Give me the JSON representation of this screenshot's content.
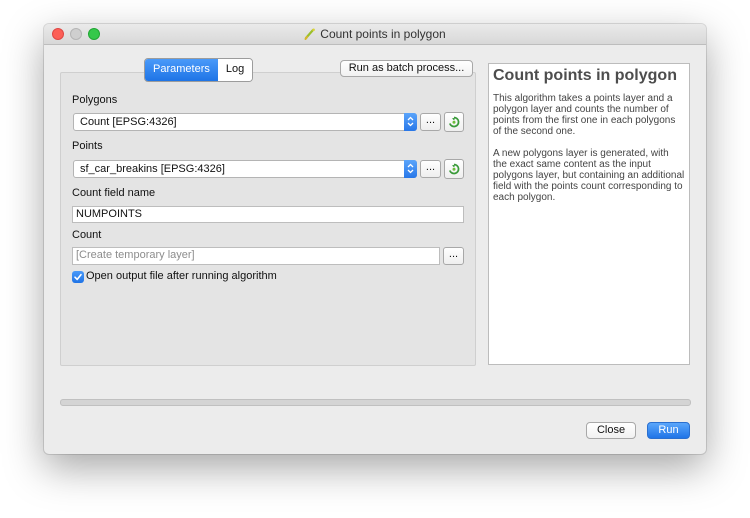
{
  "window": {
    "title": "Count points in polygon"
  },
  "tabs": [
    {
      "label": "Parameters",
      "active": true
    },
    {
      "label": "Log",
      "active": false
    }
  ],
  "batch_button_label": "Run as batch process...",
  "fields": {
    "polygons_label": "Polygons",
    "polygons_value": "Count [EPSG:4326]",
    "points_label": "Points",
    "points_value": "sf_car_breakins [EPSG:4326]",
    "count_field_label": "Count field name",
    "count_field_value": "NUMPOINTS",
    "count_label": "Count",
    "count_placeholder": "[Create temporary layer]",
    "browse_label": "...",
    "open_output_label": "Open output file after running algorithm",
    "open_output_checked": true
  },
  "help": {
    "title": "Count points in polygon",
    "paragraphs": [
      "This algorithm takes a points layer and a polygon layer and counts the number of points from the first one in each polygons of the second one.",
      "A new polygons layer is generated, with the exact same content as the input polygons layer, but containing an additional field with the points count corresponding to each polygon."
    ]
  },
  "buttons": {
    "close": "Close",
    "run": "Run"
  },
  "progress": 0,
  "colors": {
    "accent": "#2a7cec",
    "window_bg": "#ececec"
  }
}
